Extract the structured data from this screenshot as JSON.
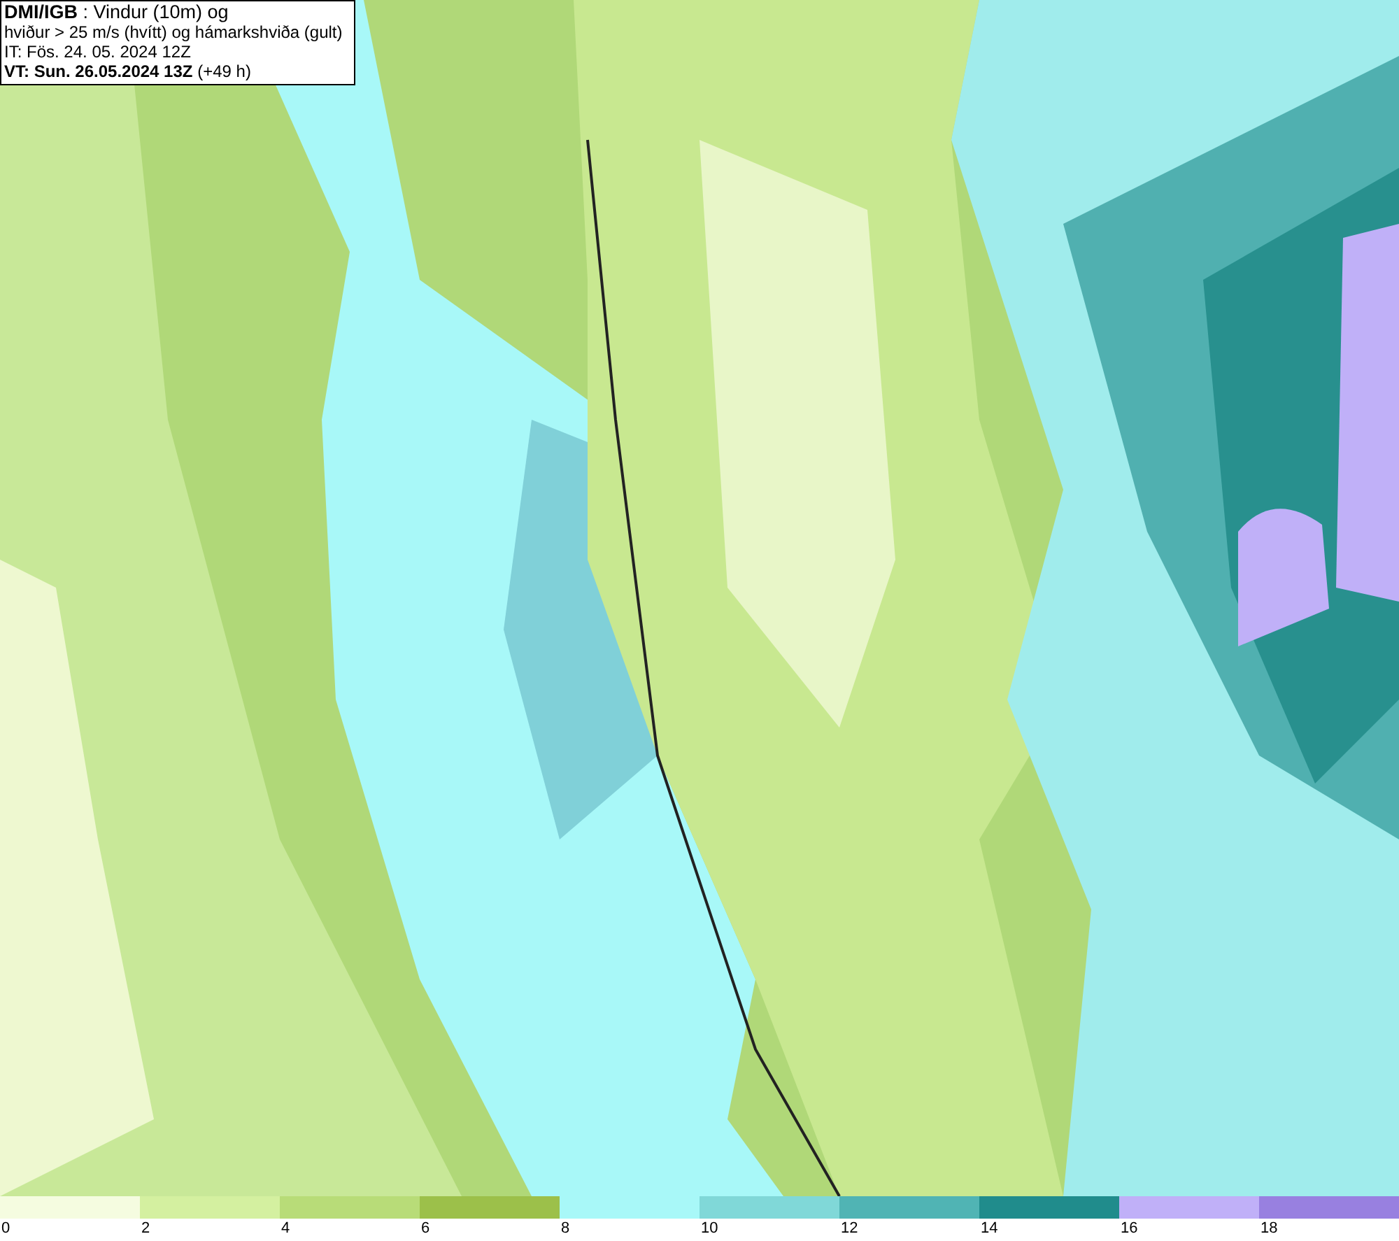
{
  "info_box": {
    "lines": [
      "**DMI/IGB** : Vindur (10m) og",
      "hviður > 25 m/s (hvítt) og hámarkshviða (gult)",
      "IT: Fös. 24. 05. 2024 12Z",
      "**VT: Sun. 26.05.2024 13Z** (+49 h)"
    ]
  },
  "legend": {
    "bins": [
      {
        "color": "#f5fce0"
      },
      {
        "color": "#d4f0a0"
      },
      {
        "color": "#b8dc78"
      },
      {
        "color": "#9cc04a"
      },
      {
        "color": "#a8f8f8"
      },
      {
        "color": "#80d8d8"
      },
      {
        "color": "#50b4b4"
      },
      {
        "color": "#208c8c"
      },
      {
        "color": "#c0b0f8"
      },
      {
        "color": "#9880e0"
      }
    ],
    "labels": [
      "0",
      "2",
      "4",
      "6",
      "8",
      "10",
      "12",
      "14",
      "16",
      "18"
    ]
  }
}
